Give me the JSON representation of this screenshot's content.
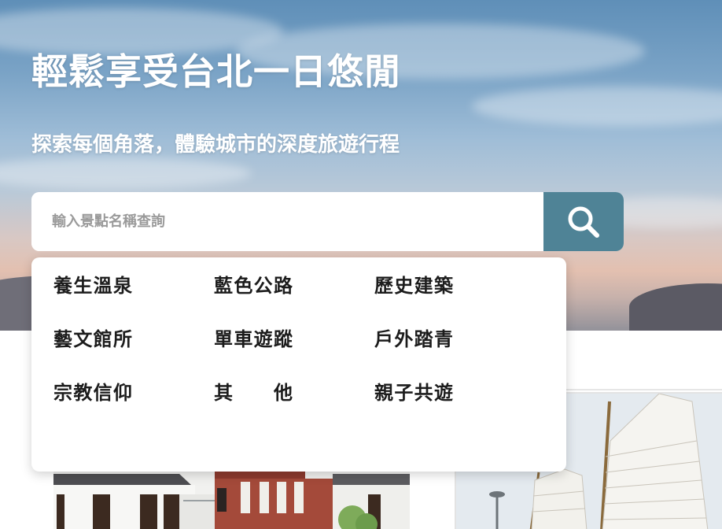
{
  "hero": {
    "title": "輕鬆享受台北一日悠閒",
    "subtitle": "探索每個角落，體驗城市的深度旅遊行程"
  },
  "search": {
    "placeholder": "輸入景點名稱查詢",
    "value": "",
    "button_icon": "search-icon"
  },
  "dropdown": {
    "items": [
      {
        "label": "養生溫泉"
      },
      {
        "label": "藍色公路"
      },
      {
        "label": "歷史建築"
      },
      {
        "label": "藝文館所"
      },
      {
        "label": "單車遊蹤"
      },
      {
        "label": "戶外踏青"
      },
      {
        "label": "宗教信仰"
      },
      {
        "label": "其　　他"
      },
      {
        "label": "親子共遊"
      }
    ]
  },
  "colors": {
    "search_button": "#4f8396",
    "title_text": "#ffffff",
    "dropdown_text": "#1c1c1c"
  },
  "cards": [
    {
      "image": "historic-house-photo"
    },
    {
      "image": "junk-ship-photo"
    }
  ]
}
